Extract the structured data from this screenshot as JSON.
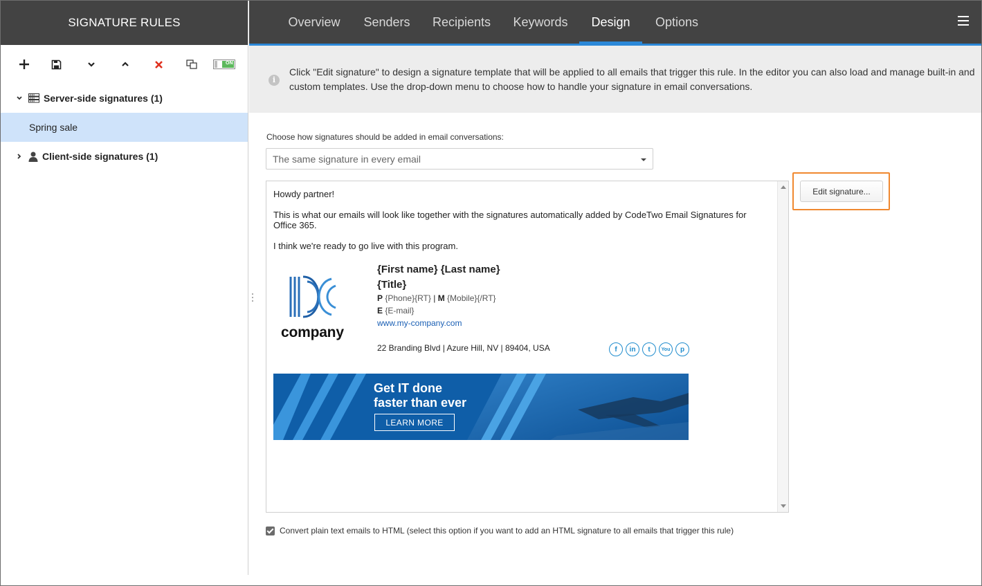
{
  "sidebar": {
    "title": "SIGNATURE RULES",
    "toolbar": {
      "toggle_label": "ON",
      "icons": [
        "plus-icon",
        "save-icon",
        "move-down-icon",
        "move-up-icon",
        "delete-icon",
        "duplicate-icon",
        "toggle-switch"
      ]
    },
    "groups": [
      {
        "label": "Server-side signatures (1)",
        "icon": "server-icon",
        "expanded": true,
        "items": [
          "Spring sale"
        ]
      },
      {
        "label": "Client-side signatures (1)",
        "icon": "user-icon",
        "expanded": false,
        "items": []
      }
    ]
  },
  "nav": {
    "tabs": [
      "Overview",
      "Senders",
      "Recipients",
      "Keywords",
      "Design",
      "Options"
    ],
    "active_tab": "Design"
  },
  "info": {
    "line1": "Click \"Edit signature\" to design a signature template that will be applied to all emails that trigger this rule. In the editor you can also load and manage built-in and",
    "line2": "custom templates. Use the drop-down menu to choose how to handle your signature in email conversations."
  },
  "conversation": {
    "label": "Choose how signatures should be added in email conversations:",
    "selected": "The same signature in every email"
  },
  "preview": {
    "greeting": "Howdy partner!",
    "body1_line1": "This is what our emails will look like together with the signatures automatically added by CodeTwo Email Signatures for",
    "body1_line2": "Office 365.",
    "body2": "I think we're ready to go live with this program.",
    "logo_text": "company",
    "name": "{First name} {Last name}",
    "title": "{Title}",
    "phone_label": "P",
    "phone": "{Phone}{RT}",
    "separator": "|",
    "mobile_label": "M",
    "mobile": "{Mobile}{/RT}",
    "email_label": "E",
    "email": "{E-mail}",
    "website": "www.my-company.com",
    "address": "22 Branding Blvd | Azure Hill, NV | 89404, USA",
    "social": [
      "facebook-icon",
      "linkedin-icon",
      "twitter-icon",
      "youtube-icon",
      "pinterest-icon"
    ],
    "social_glyphs": [
      "f",
      "in",
      "t",
      "You",
      "p"
    ],
    "banner": {
      "headline1": "Get IT done",
      "headline2": "faster than ever",
      "button": "LEARN MORE"
    }
  },
  "edit_button": "Edit signature...",
  "convert_option": {
    "checked": true,
    "label": "Convert plain text emails to HTML (select this option if you want to add an HTML signature to all emails that trigger this rule)"
  },
  "colors": {
    "header_bg": "#434343",
    "accent": "#2b88d8",
    "selected_item": "#cfe3fa",
    "highlight": "#f0882f",
    "delete_red": "#e0301e",
    "toggle_green": "#5cb85c"
  }
}
